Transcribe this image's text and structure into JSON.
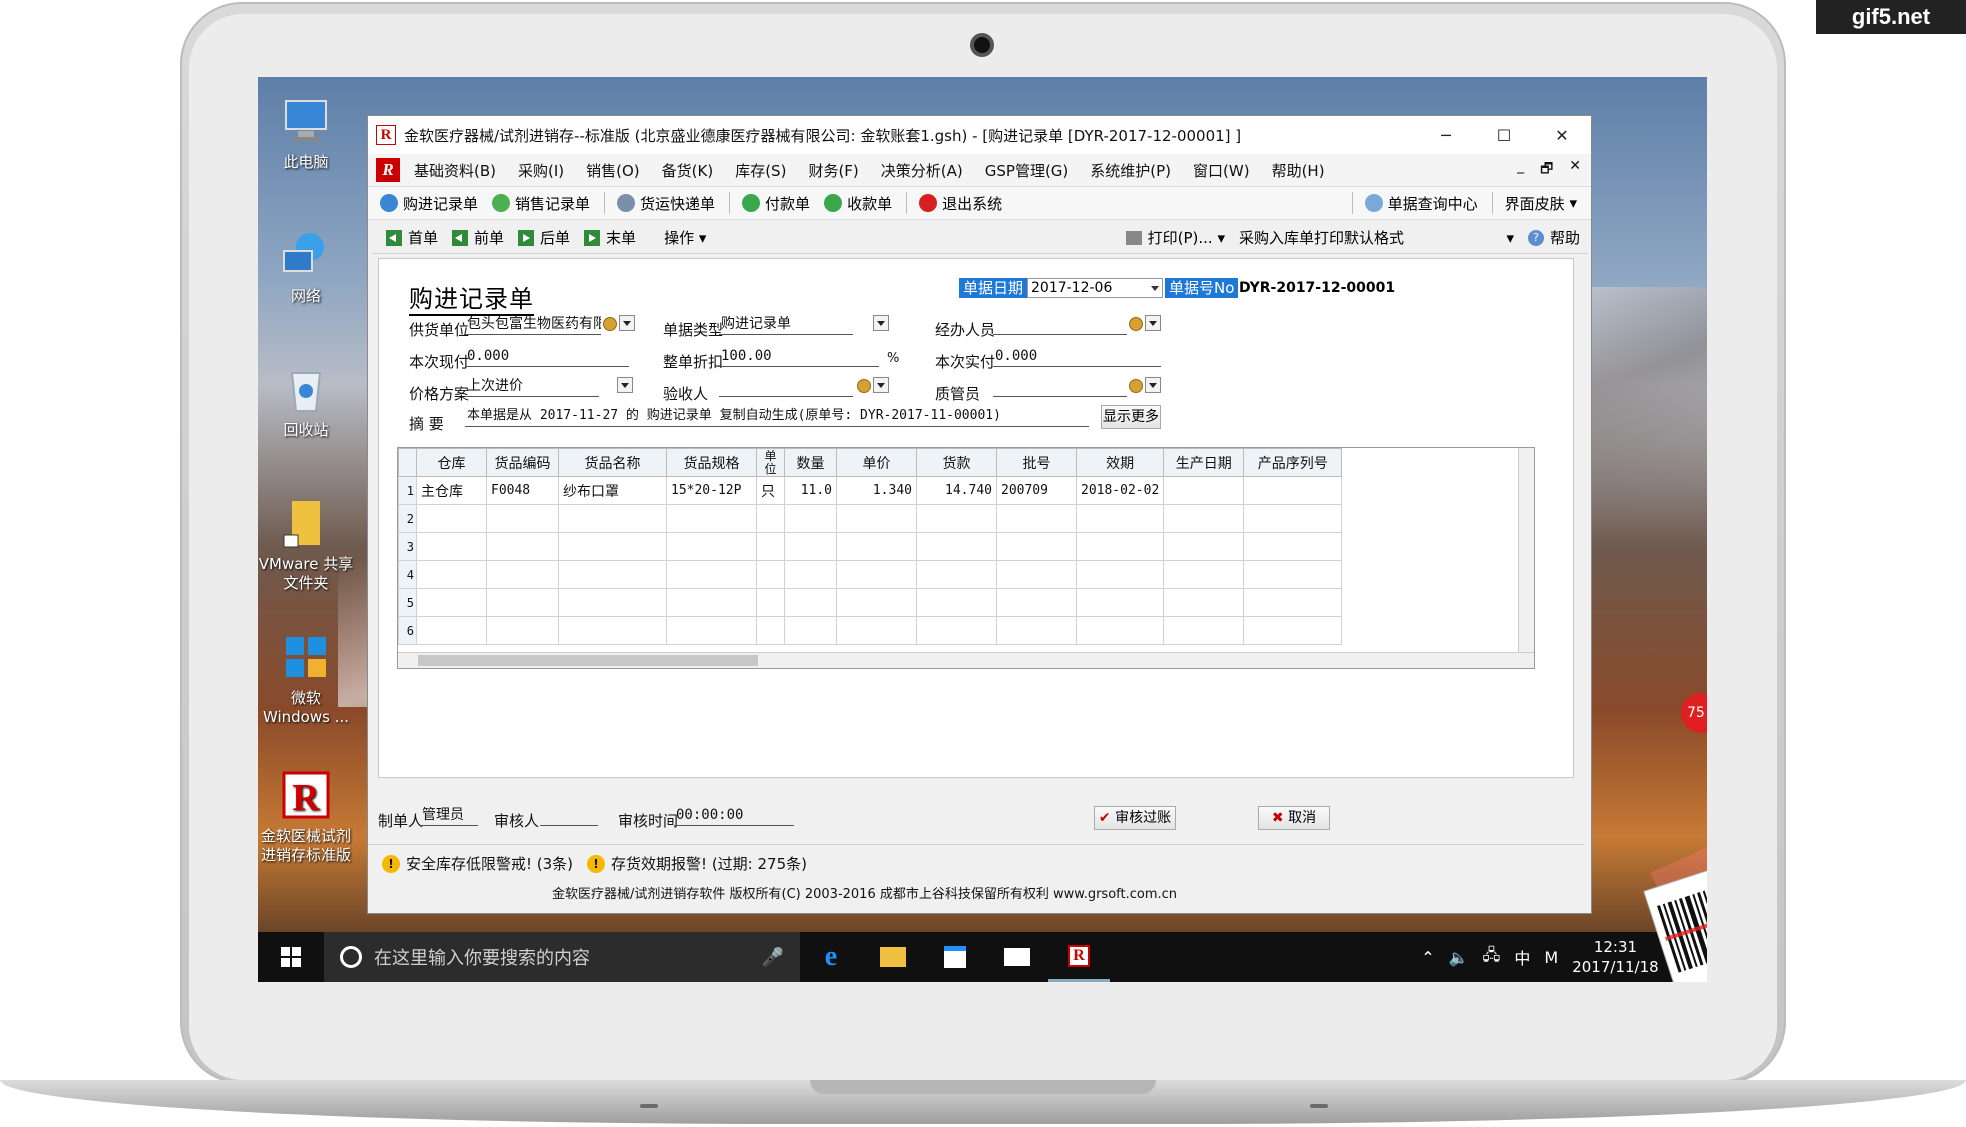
{
  "watermark": "gif5.net",
  "desktop": {
    "icons": [
      "此电脑",
      "网络",
      "回收站",
      "VMware 共享文件夹",
      "微软 Windows ...",
      "金软医械试剂进销存标准版"
    ]
  },
  "window": {
    "title": "金软医疗器械/试剂进销存--标准版 (北京盛业德康医疗器械有限公司: 金软账套1.gsh) - [购进记录单 [DYR-2017-12-00001] ]",
    "controls": {
      "minimize": "─",
      "maximize": "☐",
      "close": "✕"
    }
  },
  "menu": {
    "items": [
      "基础资料(B)",
      "采购(I)",
      "销售(O)",
      "备货(K)",
      "库存(S)",
      "财务(F)",
      "决策分析(A)",
      "GSP管理(G)",
      "系统维护(P)",
      "窗口(W)",
      "帮助(H)"
    ],
    "mdi": {
      "min": "_",
      "restore": "🗗",
      "close": "✕"
    }
  },
  "toolbar": {
    "items": [
      "购进记录单",
      "销售记录单",
      "货运快递单",
      "付款单",
      "收款单",
      "退出系统"
    ],
    "right": [
      "单据查询中心",
      "界面皮肤"
    ]
  },
  "nav": {
    "items": [
      "首单",
      "前单",
      "后单",
      "末单"
    ],
    "operate": "操作",
    "print": "打印(P)...",
    "print_format": "采购入库单打印默认格式",
    "help": "帮助"
  },
  "form": {
    "title": "购进记录单",
    "date_label": "单据日期",
    "date_value": "2017-12-06",
    "no_label": "单据号No",
    "no_value": "DYR-2017-12-00001",
    "supplier_label": "供货单位",
    "supplier_value": "包头包富生物医药有限公司",
    "doc_type_label": "单据类型",
    "doc_type_value": "购进记录单",
    "handler_label": "经办人员",
    "handler_value": "",
    "cash_label": "本次现付",
    "cash_value": "0.000",
    "discount_label": "整单折扣",
    "discount_value": "100.00",
    "discount_unit": "%",
    "actual_label": "本次实付",
    "actual_value": "0.000",
    "price_label": "价格方案",
    "price_value": "上次进价",
    "inspector_label": "验收人",
    "inspector_value": "",
    "qa_label": "质管员",
    "qa_value": "",
    "summary_label": "摘 要",
    "summary_value": "本单据是从 2017-11-27 的 购进记录单 复制自动生成(原单号: DYR-2017-11-00001)",
    "show_more": "显示更多"
  },
  "grid": {
    "columns": [
      "仓库",
      "货品编码",
      "货品名称",
      "货品规格",
      "单位",
      "数量",
      "单价",
      "货款",
      "批号",
      "效期",
      "生产日期",
      "产品序列号"
    ],
    "rows": [
      {
        "n": "1",
        "cells": [
          "主仓库",
          "F0048",
          "纱布口罩",
          "15*20-12P",
          "只",
          "11.0",
          "1.340",
          "14.740",
          "200709",
          "2018-02-02",
          "",
          ""
        ]
      },
      {
        "n": "2",
        "cells": [
          "",
          "",
          "",
          "",
          "",
          "",
          "",
          "",
          "",
          "",
          "",
          ""
        ]
      },
      {
        "n": "3",
        "cells": [
          "",
          "",
          "",
          "",
          "",
          "",
          "",
          "",
          "",
          "",
          "",
          ""
        ]
      },
      {
        "n": "4",
        "cells": [
          "",
          "",
          "",
          "",
          "",
          "",
          "",
          "",
          "",
          "",
          "",
          ""
        ]
      },
      {
        "n": "5",
        "cells": [
          "",
          "",
          "",
          "",
          "",
          "",
          "",
          "",
          "",
          "",
          "",
          ""
        ]
      },
      {
        "n": "6",
        "cells": [
          "",
          "",
          "",
          "",
          "",
          "",
          "",
          "",
          "",
          "",
          "",
          ""
        ]
      }
    ]
  },
  "footer": {
    "maker_label": "制单人",
    "maker_value": "管理员",
    "auditor_label": "审核人",
    "auditor_value": "",
    "audit_time_label": "审核时间",
    "audit_time_value": "00:00:00",
    "audit_btn": "审核过账",
    "cancel_btn": "取消"
  },
  "status": {
    "alert1": "安全库存低限警戒! (3条)",
    "alert2": "存货效期报警! (过期: 275条)",
    "copyright": "金软医疗器械/试剂进销存软件 版权所有(C) 2003-2016 成都市上谷科技保留所有权利 www.grsoft.com.cn"
  },
  "taskbar": {
    "search_placeholder": "在这里输入你要搜索的内容",
    "ime": "中",
    "ime2": "M",
    "time": "12:31",
    "date": "2017/11/18",
    "badge": "75"
  },
  "colors": {
    "accent": "#1e78d8",
    "brand": "#cc0000",
    "taskbar": "#101010"
  }
}
